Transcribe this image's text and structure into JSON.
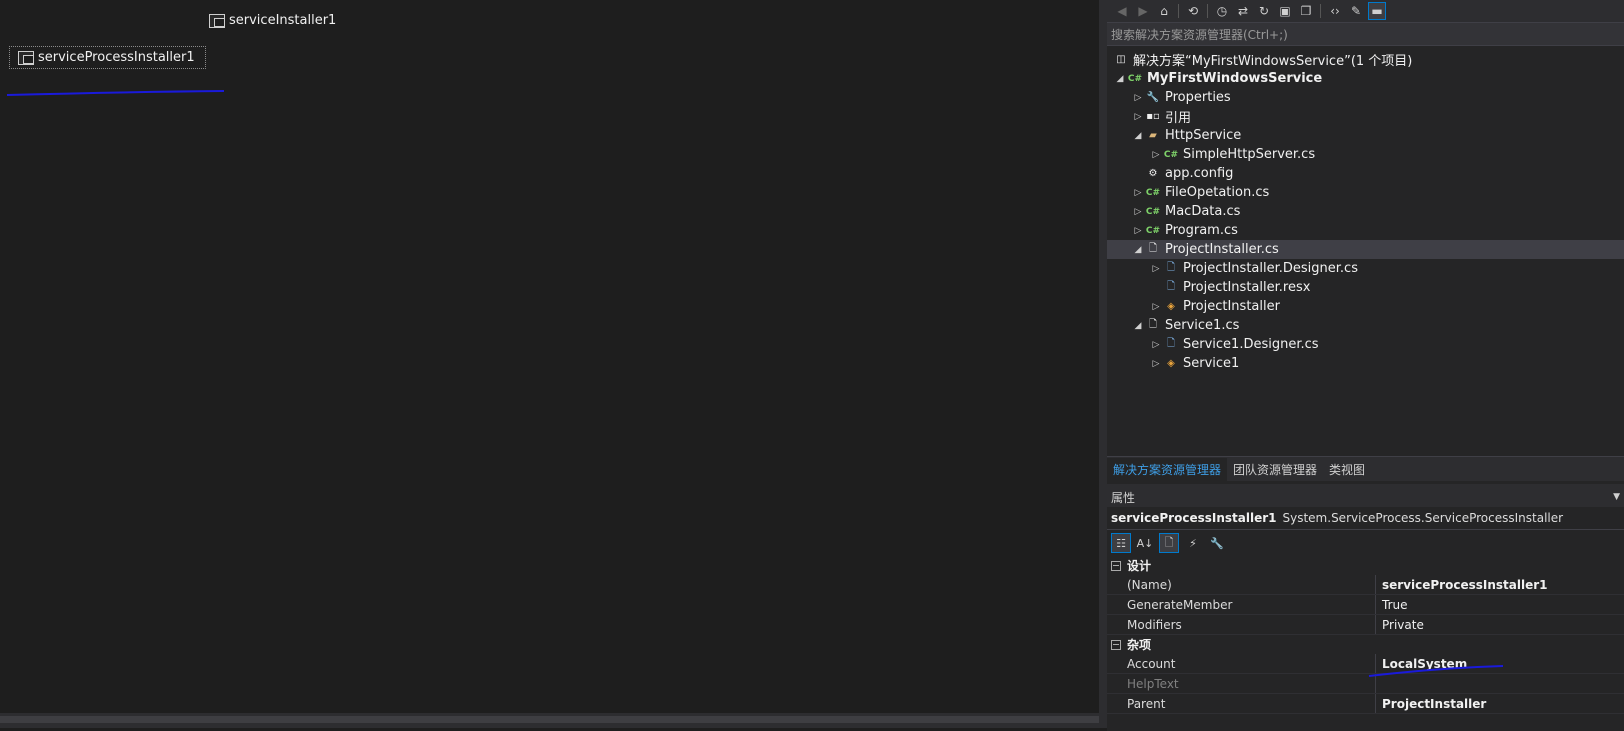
{
  "designer": {
    "components": [
      {
        "label": "serviceInstaller1"
      },
      {
        "label": "serviceProcessInstaller1"
      }
    ]
  },
  "solution_explorer": {
    "search_placeholder": "搜索解决方案资源管理器(Ctrl+;)",
    "solution_label": "解决方案“MyFirstWindowsService”(1 个项目)",
    "tree": [
      {
        "label": "MyFirstWindowsService",
        "icon": "csharp-project-icon"
      },
      {
        "label": "Properties",
        "icon": "wrench-icon"
      },
      {
        "label": "引用",
        "icon": "references-icon"
      },
      {
        "label": "HttpService",
        "icon": "folder-icon"
      },
      {
        "label": "SimpleHttpServer.cs",
        "icon": "csharp-file-icon"
      },
      {
        "label": "app.config",
        "icon": "config-file-icon"
      },
      {
        "label": "FileOpetation.cs",
        "icon": "csharp-file-icon"
      },
      {
        "label": "MacData.cs",
        "icon": "csharp-file-icon"
      },
      {
        "label": "Program.cs",
        "icon": "csharp-file-icon"
      },
      {
        "label": "ProjectInstaller.cs",
        "icon": "component-file-icon"
      },
      {
        "label": "ProjectInstaller.Designer.cs",
        "icon": "designer-file-icon"
      },
      {
        "label": "ProjectInstaller.resx",
        "icon": "resx-file-icon"
      },
      {
        "label": "ProjectInstaller",
        "icon": "class-icon"
      },
      {
        "label": "Service1.cs",
        "icon": "component-file-icon"
      },
      {
        "label": "Service1.Designer.cs",
        "icon": "designer-file-icon"
      },
      {
        "label": "Service1",
        "icon": "class-icon"
      }
    ],
    "tabs": [
      "解决方案资源管理器",
      "团队资源管理器",
      "类视图"
    ]
  },
  "properties": {
    "title": "属性",
    "object_name": "serviceProcessInstaller1",
    "object_type": "System.ServiceProcess.ServiceProcessInstaller",
    "categories": [
      {
        "name": "设计",
        "rows": [
          {
            "name": "(Name)",
            "value": "serviceProcessInstaller1"
          },
          {
            "name": "GenerateMember",
            "value": "True"
          },
          {
            "name": "Modifiers",
            "value": "Private"
          }
        ]
      },
      {
        "name": "杂项",
        "rows": [
          {
            "name": "Account",
            "value": "LocalSystem"
          },
          {
            "name": "HelpText",
            "value": ""
          },
          {
            "name": "Parent",
            "value": "ProjectInstaller"
          }
        ]
      }
    ]
  },
  "colors": {
    "accent": "#007acc",
    "tab_active": "#3e9ee6",
    "annotation": "#1a1adb"
  }
}
